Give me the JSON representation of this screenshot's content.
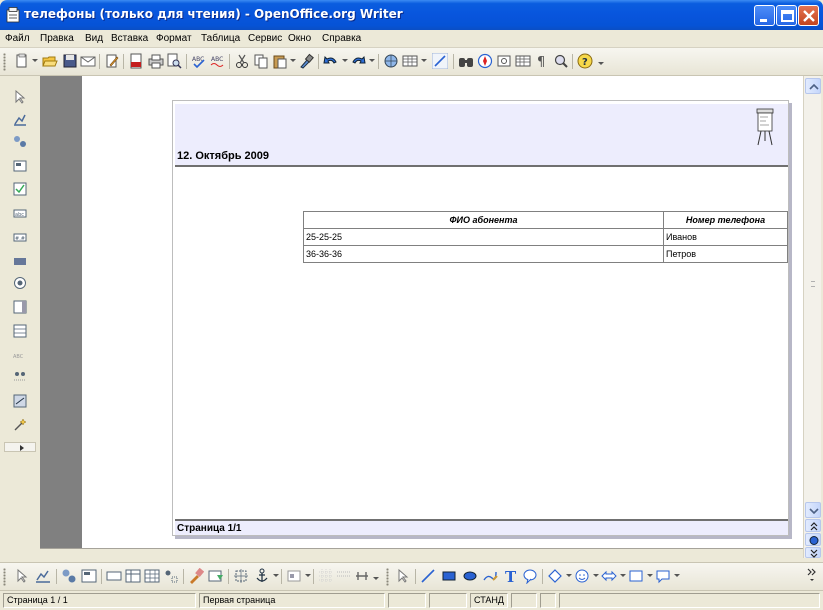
{
  "window": {
    "title": "телефоны (только для чтения) - OpenOffice.org Writer"
  },
  "menu": {
    "items": [
      "Файл",
      "Правка",
      "Вид",
      "Вставка",
      "Формат",
      "Таблица",
      "Сервис",
      "Окно",
      "Справка"
    ]
  },
  "toolbar": {
    "icons": [
      "new-icon",
      "open-icon",
      "save-icon",
      "email-icon",
      "edit-file-icon",
      "export-pdf-icon",
      "print-icon",
      "page-preview-icon",
      "spellcheck-icon",
      "autospellcheck-icon",
      "cut-icon",
      "copy-icon",
      "paste-icon",
      "format-paintbrush-icon",
      "undo-icon",
      "redo-icon",
      "hyperlink-icon",
      "table-icon",
      "show-draw-functions-icon",
      "find-replace-icon",
      "navigator-icon",
      "gallery-icon",
      "data-sources-icon",
      "nonprinting-chars-icon",
      "zoom-icon",
      "help-icon"
    ]
  },
  "document": {
    "header_date": "12. Октябрь 2009",
    "table": {
      "headers": [
        "ФИО абонента",
        "Номер телефона"
      ],
      "rows": [
        [
          "25-25-25",
          "Иванов"
        ],
        [
          "36-36-36",
          "Петров"
        ]
      ]
    },
    "footer": "Страница 1/1"
  },
  "statusbar": {
    "page": "Страница  1 / 1",
    "style": "Первая страница",
    "mode": "СТАНД"
  },
  "colors": {
    "title_bar": "#0855dd",
    "header_fill": "#ededfd",
    "doc_background": "#808080"
  }
}
